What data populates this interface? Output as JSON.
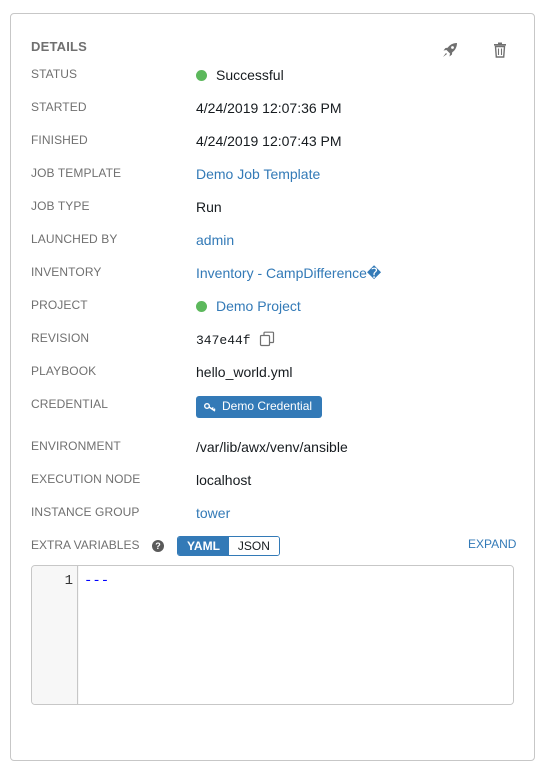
{
  "panel": {
    "title": "DETAILS",
    "icons": {
      "launch": "rocket-icon",
      "delete": "trash-icon"
    }
  },
  "details": {
    "status": {
      "label": "STATUS",
      "value": "Successful",
      "color": "#5cb85c"
    },
    "started": {
      "label": "STARTED",
      "value": "4/24/2019 12:07:36 PM"
    },
    "finished": {
      "label": "FINISHED",
      "value": "4/24/2019 12:07:43 PM"
    },
    "job_template": {
      "label": "JOB TEMPLATE",
      "value": "Demo Job Template"
    },
    "job_type": {
      "label": "JOB TYPE",
      "value": "Run"
    },
    "launched_by": {
      "label": "LAUNCHED BY",
      "value": "admin"
    },
    "inventory": {
      "label": "INVENTORY",
      "value": "Inventory - CampDifference�"
    },
    "project": {
      "label": "PROJECT",
      "value": "Demo Project",
      "color": "#5cb85c"
    },
    "revision": {
      "label": "REVISION",
      "value": "347e44f"
    },
    "playbook": {
      "label": "PLAYBOOK",
      "value": "hello_world.yml"
    },
    "credential": {
      "label": "CREDENTIAL",
      "value": "Demo Credential"
    },
    "environment": {
      "label": "ENVIRONMENT",
      "value": "/var/lib/awx/venv/ansible"
    },
    "execution_node": {
      "label": "EXECUTION NODE",
      "value": "localhost"
    },
    "instance_group": {
      "label": "INSTANCE GROUP",
      "value": "tower"
    }
  },
  "extra_vars": {
    "label": "EXTRA VARIABLES",
    "help": "?",
    "toggle": {
      "yaml": "YAML",
      "json": "JSON",
      "selected": "YAML"
    },
    "expand_label": "EXPAND",
    "line_number": "1",
    "content": "---"
  },
  "colors": {
    "accent": "#337ab7",
    "success": "#5cb85c",
    "label": "#707070"
  }
}
